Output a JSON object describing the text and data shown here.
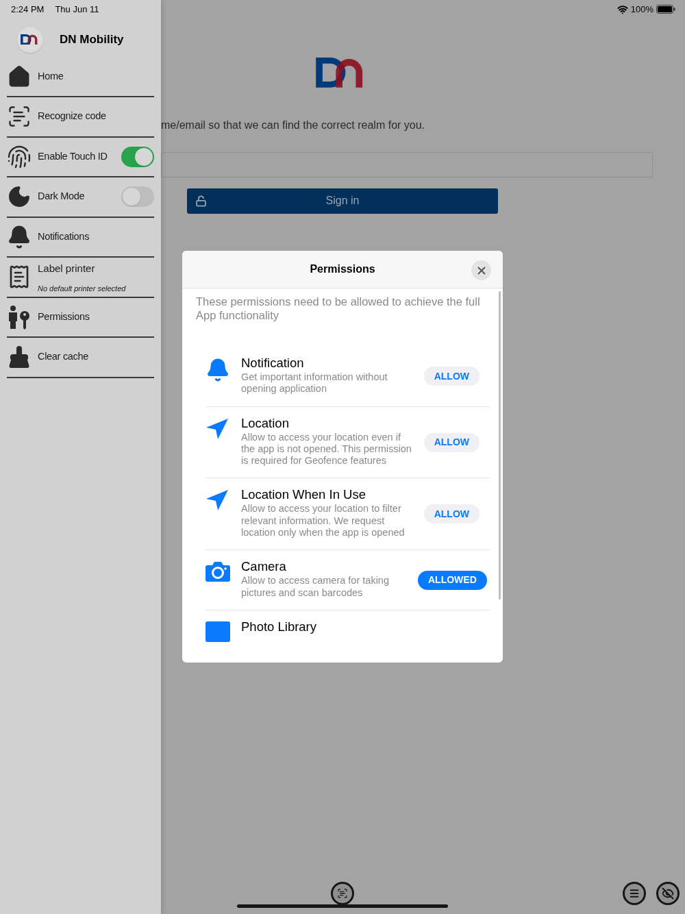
{
  "status_bar": {
    "time": "2:24 PM",
    "date": "Thu Jun 11",
    "battery": "100%"
  },
  "sidebar": {
    "app_name": "DN Mobility",
    "items": [
      {
        "kind": "link",
        "label": "Home"
      },
      {
        "kind": "link",
        "label": "Recognize code"
      },
      {
        "kind": "toggle",
        "label": "Enable Touch ID",
        "on": true
      },
      {
        "kind": "toggle",
        "label": "Dark Mode",
        "on": false
      },
      {
        "kind": "link",
        "label": "Notifications"
      },
      {
        "kind": "subtitle",
        "label": "Label printer",
        "subtitle": "No default printer selected"
      },
      {
        "kind": "link",
        "label": "Permissions"
      },
      {
        "kind": "link",
        "label": "Clear cache"
      }
    ]
  },
  "page": {
    "instruction": "me/email so that we can find the correct realm for you.",
    "sign_in_button": "Sign in"
  },
  "dialog": {
    "title": "Permissions",
    "intro": "These permissions need to be allowed to achieve the full App functionality",
    "permissions": [
      {
        "title": "Notification",
        "description": "Get important information without opening application",
        "button": "ALLOW",
        "granted": false
      },
      {
        "title": "Location",
        "description": "Allow to access your location even if the app is not opened. This permission is required for Geofence features",
        "button": "ALLOW",
        "granted": false
      },
      {
        "title": "Location When In Use",
        "description": "Allow to access your location to filter relevant information. We request location only when the app is opened",
        "button": "ALLOW",
        "granted": false
      },
      {
        "title": "Camera",
        "description": "Allow to access camera for taking pictures and scan barcodes",
        "button": "ALLOWED",
        "granted": true
      },
      {
        "title": "Photo Library"
      }
    ]
  }
}
